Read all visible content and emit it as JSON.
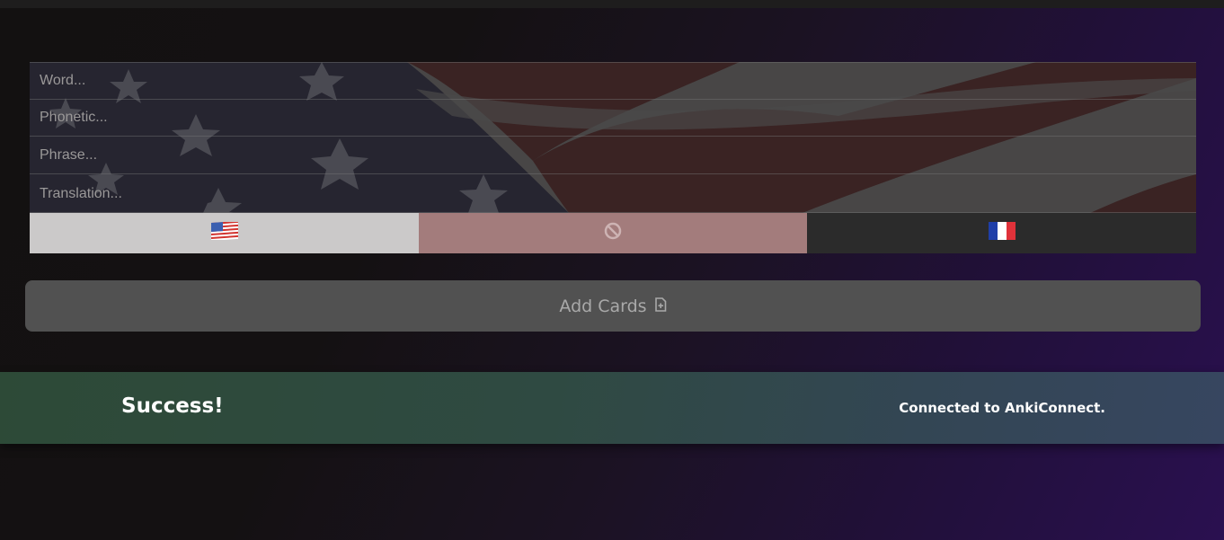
{
  "fields": {
    "word_placeholder": "Word...",
    "phonetic_placeholder": "Phonetic...",
    "phrase_placeholder": "Phrase...",
    "translation_placeholder": "Translation..."
  },
  "languages": [
    {
      "name": "us-flag-icon",
      "selected": true,
      "color": "#cbc9c9"
    },
    {
      "name": "ban-icon",
      "selected": false,
      "color": "#a37c7c"
    },
    {
      "name": "fr-flag-icon",
      "selected": false,
      "color": "#2b2b2b"
    }
  ],
  "add_button": {
    "label": "Add Cards",
    "icon": "file-plus-icon"
  },
  "toast": {
    "title": "Success!",
    "message": "Connected to AnkiConnect."
  },
  "colors": {
    "success_start": "#2d4a37",
    "success_end": "#374660",
    "background_accent": "#2a1050"
  }
}
